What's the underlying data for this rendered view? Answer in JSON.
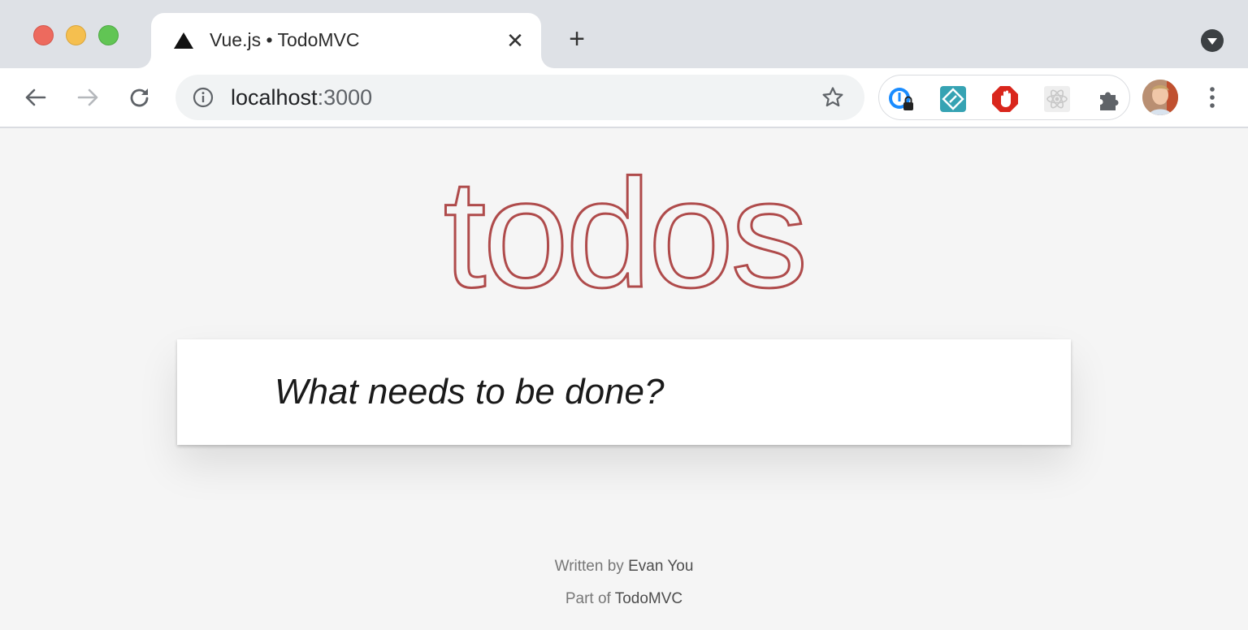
{
  "browser": {
    "tab": {
      "title": "Vue.js • TodoMVC",
      "close_symbol": "✕"
    },
    "new_tab_symbol": "+",
    "address_bar": {
      "host": "localhost",
      "port": ":3000"
    }
  },
  "extensions": [
    {
      "name": "password-manager-icon"
    },
    {
      "name": "code-extension-icon"
    },
    {
      "name": "ad-blocker-icon"
    },
    {
      "name": "react-devtools-icon"
    },
    {
      "name": "extensions-puzzle-icon"
    }
  ],
  "app": {
    "title": "todos",
    "new_todo_placeholder": "What needs to be done?"
  },
  "footer": {
    "written_by_prefix": "Written by ",
    "author": "Evan You",
    "part_of_prefix": "Part of ",
    "project": "TodoMVC"
  },
  "colors": {
    "title": "#af4b4b",
    "page_bg": "#f5f5f5",
    "tabstrip_bg": "#dee1e6"
  }
}
